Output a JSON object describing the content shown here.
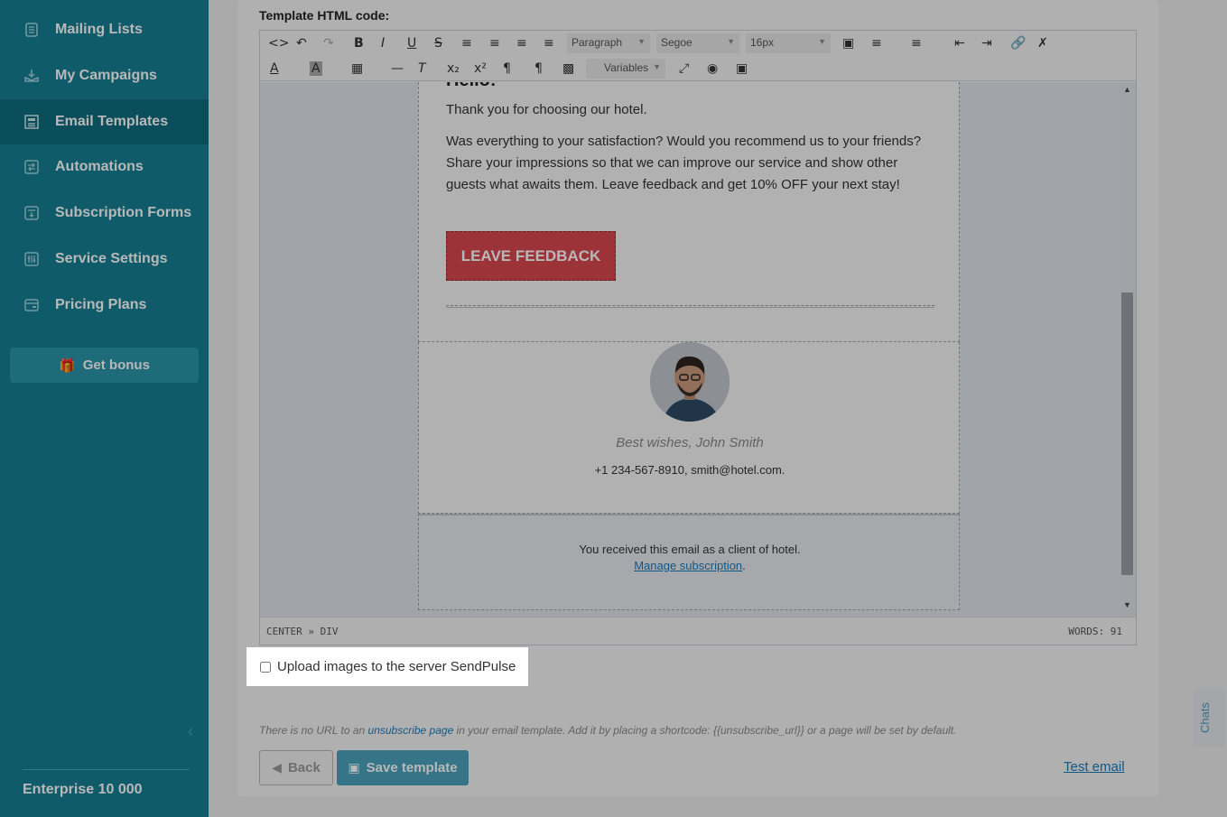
{
  "sidebar": {
    "items": [
      {
        "label": "Mailing Lists",
        "icon": "mailing-list-icon"
      },
      {
        "label": "My Campaigns",
        "icon": "campaign-icon"
      },
      {
        "label": "Email Templates",
        "icon": "template-icon",
        "active": true
      },
      {
        "label": "Automations",
        "icon": "automation-icon"
      },
      {
        "label": "Subscription Forms",
        "icon": "form-icon"
      },
      {
        "label": "Service Settings",
        "icon": "settings-icon"
      },
      {
        "label": "Pricing Plans",
        "icon": "pricing-icon"
      }
    ],
    "bonus_label": "Get bonus",
    "plan_label": "Enterprise 10 000"
  },
  "editor": {
    "section_label": "Template HTML code:",
    "toolbar": {
      "format_select": "Paragraph",
      "font_select": "Segoe",
      "size_select": "16px",
      "variables_select": "Variables"
    },
    "status_path": "CENTER » DIV",
    "word_count": "WORDS: 91"
  },
  "email": {
    "heading": "Hello!",
    "intro": "Thank you for choosing our hotel.",
    "body": "Was everything to your satisfaction? Would you recommend us to your friends? Share your impressions so that we can improve our service and show other guests what awaits them. Leave feedback and get 10% OFF your next stay!",
    "cta_label": "LEAVE FEEDBACK",
    "signature": "Best wishes, John Smith",
    "contact": "+1 234-567-8910, smith@hotel.com.",
    "footer_text": "You received this email as a client of hotel.",
    "footer_link": "Manage subscription",
    "footer_period": "."
  },
  "upload": {
    "label": "Upload images to the server SendPulse",
    "checked": false
  },
  "notice": {
    "before": "There is no URL to an ",
    "link": "unsubscribe page",
    "after": " in your email template. Add it by placing a shortcode: {{unsubscribe_url}} or a page will be set by default."
  },
  "actions": {
    "back_label": "Back",
    "save_label": "Save template",
    "test_label": "Test email"
  },
  "chats_label": "Chats",
  "colors": {
    "sidebar": "#157f93",
    "accent": "#4aa3bb",
    "cta": "#d9474f",
    "link": "#1a7ab7"
  }
}
